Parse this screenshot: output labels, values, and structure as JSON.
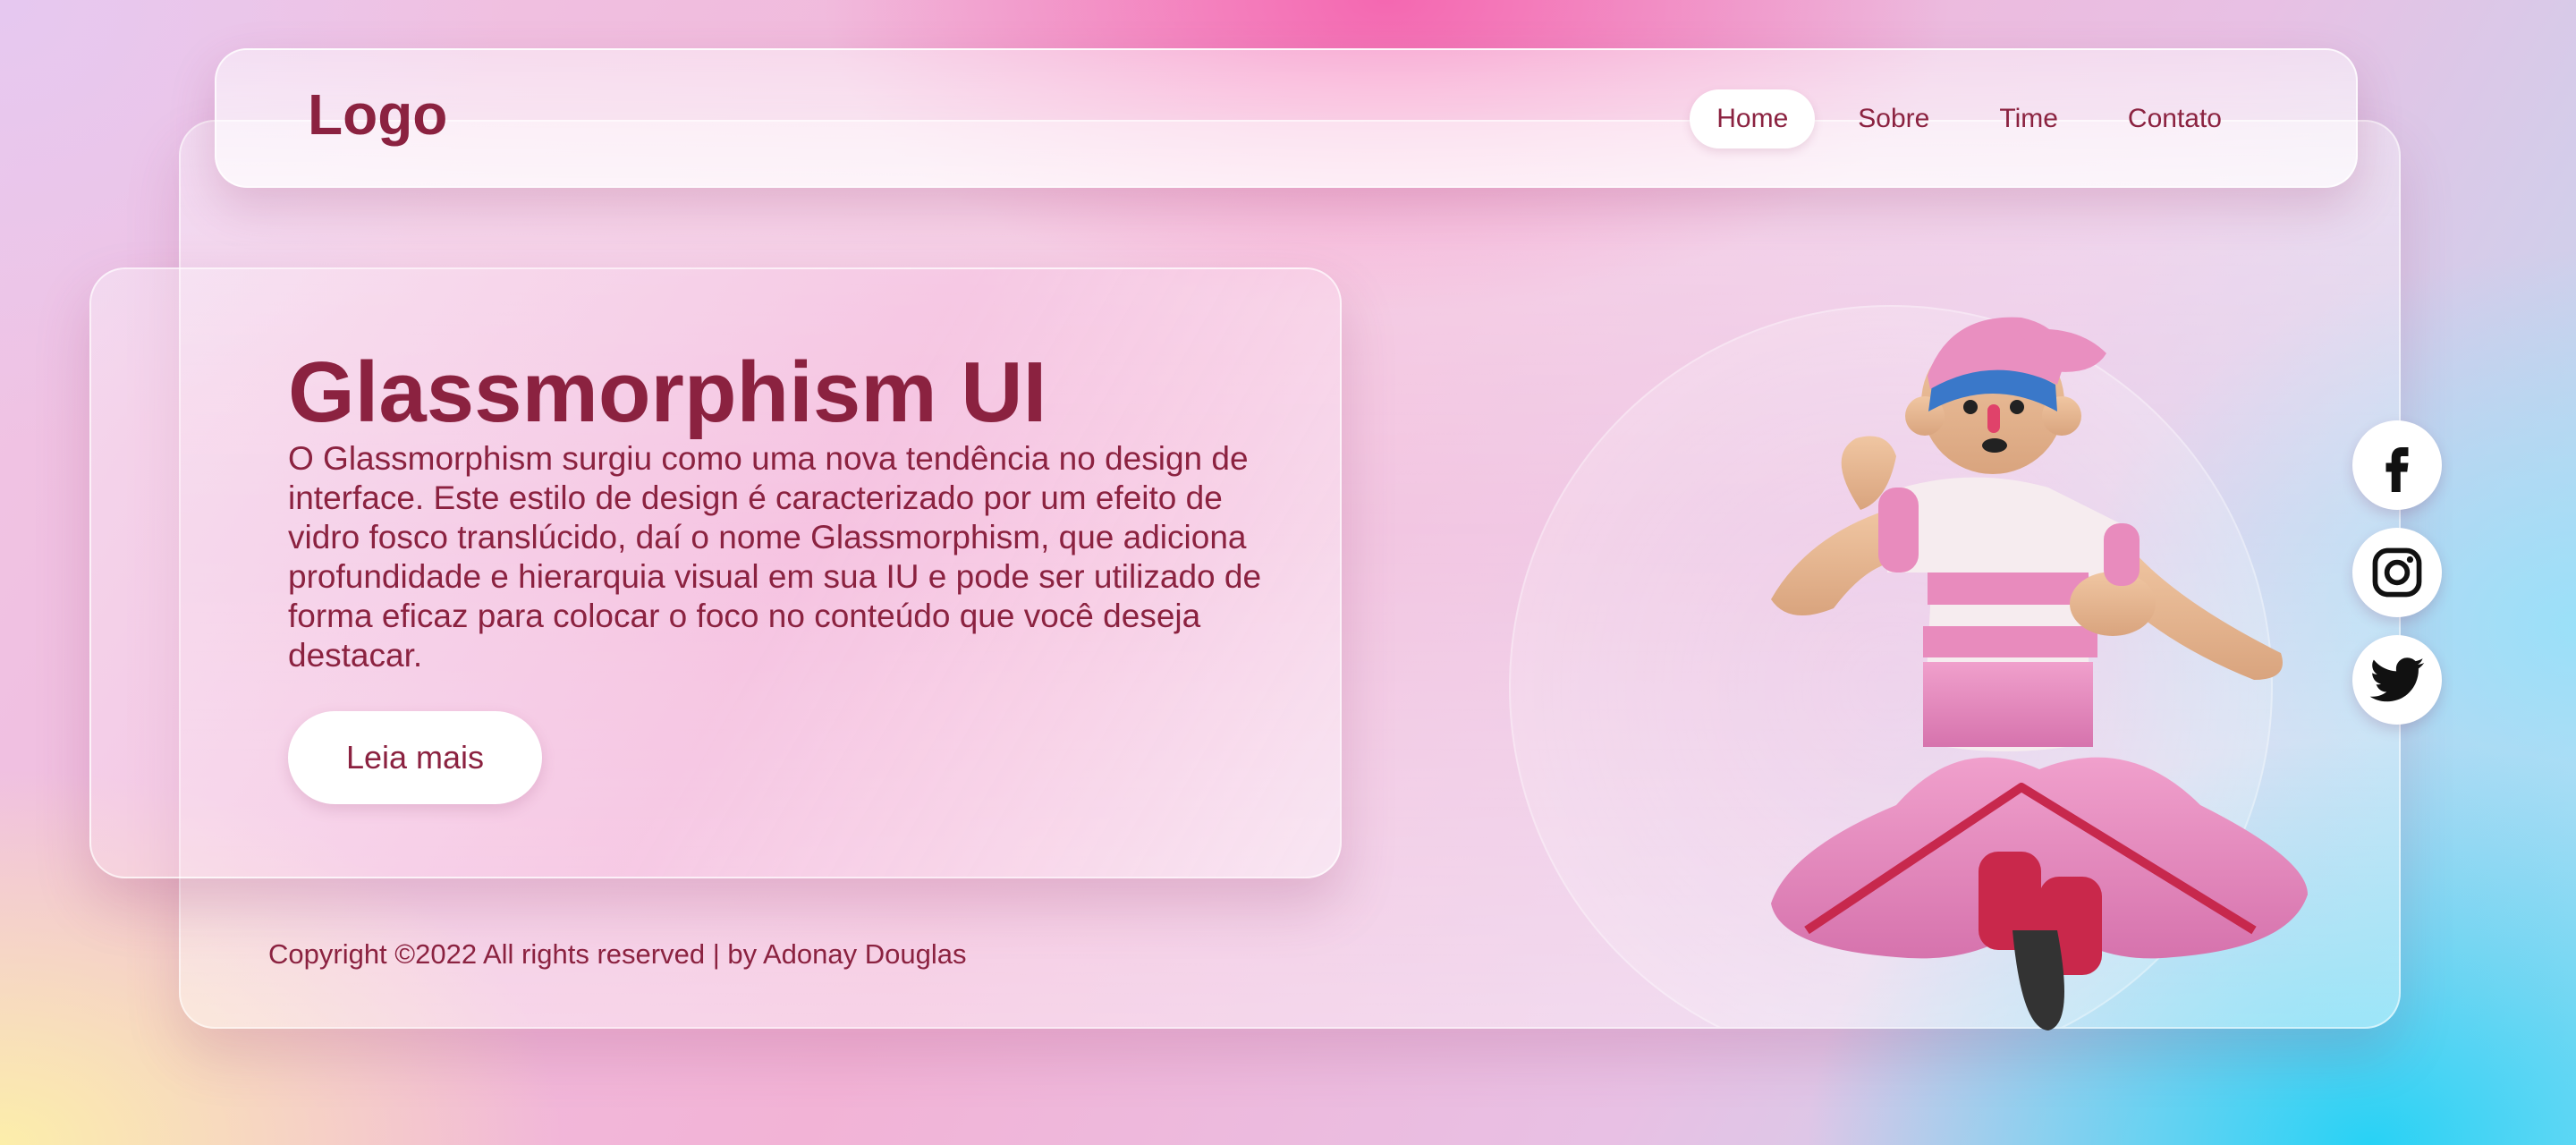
{
  "header": {
    "logo": "Logo",
    "nav": [
      {
        "label": "Home",
        "active": true
      },
      {
        "label": "Sobre",
        "active": false
      },
      {
        "label": "Time",
        "active": false
      },
      {
        "label": "Contato",
        "active": false
      }
    ]
  },
  "hero": {
    "title": "Glassmorphism UI",
    "text": "O Glassmorphism surgiu como uma nova tendência no design de interface. Este estilo de design é caracterizado por um efeito de vidro fosco translúcido, daí o nome Glassmorphism, que adiciona profundidade e hierarquia visual em sua IU e pode ser utilizado de forma eficaz para colocar o foco no conteúdo que você deseja destacar.",
    "button_label": "Leia mais"
  },
  "footer": {
    "copyright": "Copyright ©2022 All rights reserved | by Adonay Douglas"
  },
  "social": [
    {
      "icon": "facebook-icon"
    },
    {
      "icon": "instagram-icon"
    },
    {
      "icon": "twitter-icon"
    }
  ],
  "colors": {
    "accent": "#8b2240",
    "button_bg": "#ffffff"
  }
}
